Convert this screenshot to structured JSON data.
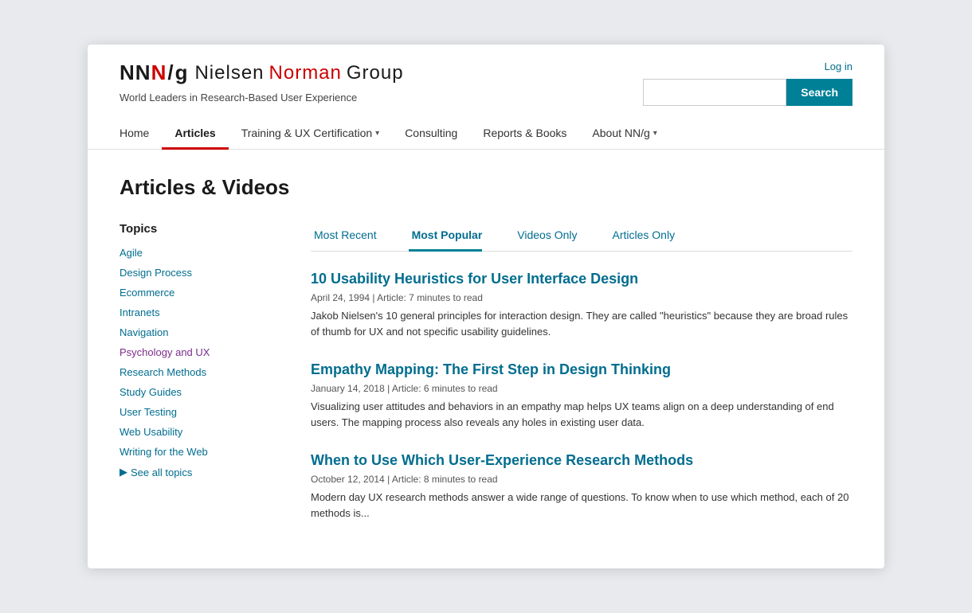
{
  "header": {
    "logo": {
      "nn": "NN",
      "n_red": "N",
      "slash": "/",
      "g": "g",
      "nielsen": "Nielsen",
      "norman": "Norman",
      "group": "Group"
    },
    "tagline": "World Leaders in Research-Based User Experience",
    "login_label": "Log in",
    "search": {
      "placeholder": "",
      "button_label": "Search"
    }
  },
  "nav": {
    "items": [
      {
        "label": "Home",
        "active": false,
        "has_chevron": false
      },
      {
        "label": "Articles",
        "active": true,
        "has_chevron": false
      },
      {
        "label": "Training & UX Certification",
        "active": false,
        "has_chevron": true
      },
      {
        "label": "Consulting",
        "active": false,
        "has_chevron": false
      },
      {
        "label": "Reports & Books",
        "active": false,
        "has_chevron": false
      },
      {
        "label": "About NN/g",
        "active": false,
        "has_chevron": true
      }
    ]
  },
  "page": {
    "title": "Articles & Videos"
  },
  "sidebar": {
    "title": "Topics",
    "links": [
      {
        "label": "Agile",
        "purple": false
      },
      {
        "label": "Design Process",
        "purple": false
      },
      {
        "label": "Ecommerce",
        "purple": false
      },
      {
        "label": "Intranets",
        "purple": false
      },
      {
        "label": "Navigation",
        "purple": false
      },
      {
        "label": "Psychology and UX",
        "purple": true
      },
      {
        "label": "Research Methods",
        "purple": false
      },
      {
        "label": "Study Guides",
        "purple": false
      },
      {
        "label": "User Testing",
        "purple": false
      },
      {
        "label": "Web Usability",
        "purple": false
      },
      {
        "label": "Writing for the Web",
        "purple": false
      }
    ],
    "see_all_label": "See all topics"
  },
  "tabs": [
    {
      "label": "Most Recent",
      "active": false
    },
    {
      "label": "Most Popular",
      "active": true
    },
    {
      "label": "Videos Only",
      "active": false
    },
    {
      "label": "Articles Only",
      "active": false
    }
  ],
  "articles": [
    {
      "title": "10 Usability Heuristics for User Interface Design",
      "meta": "April 24, 1994 | Article: 7 minutes to read",
      "excerpt": "Jakob Nielsen's 10 general principles for interaction design. They are called \"heuristics\" because they are broad rules of thumb for UX and not specific usability guidelines."
    },
    {
      "title": "Empathy Mapping: The First Step in Design Thinking",
      "meta": "January 14, 2018 | Article: 6 minutes to read",
      "excerpt": "Visualizing user attitudes and behaviors in an empathy map helps UX teams align on a deep understanding of end users. The mapping process also reveals any holes in existing user data."
    },
    {
      "title": "When to Use Which User-Experience Research Methods",
      "meta": "October 12, 2014 | Article: 8 minutes to read",
      "excerpt": "Modern day UX research methods answer a wide range of questions. To know when to use which method, each of 20 methods is..."
    }
  ]
}
